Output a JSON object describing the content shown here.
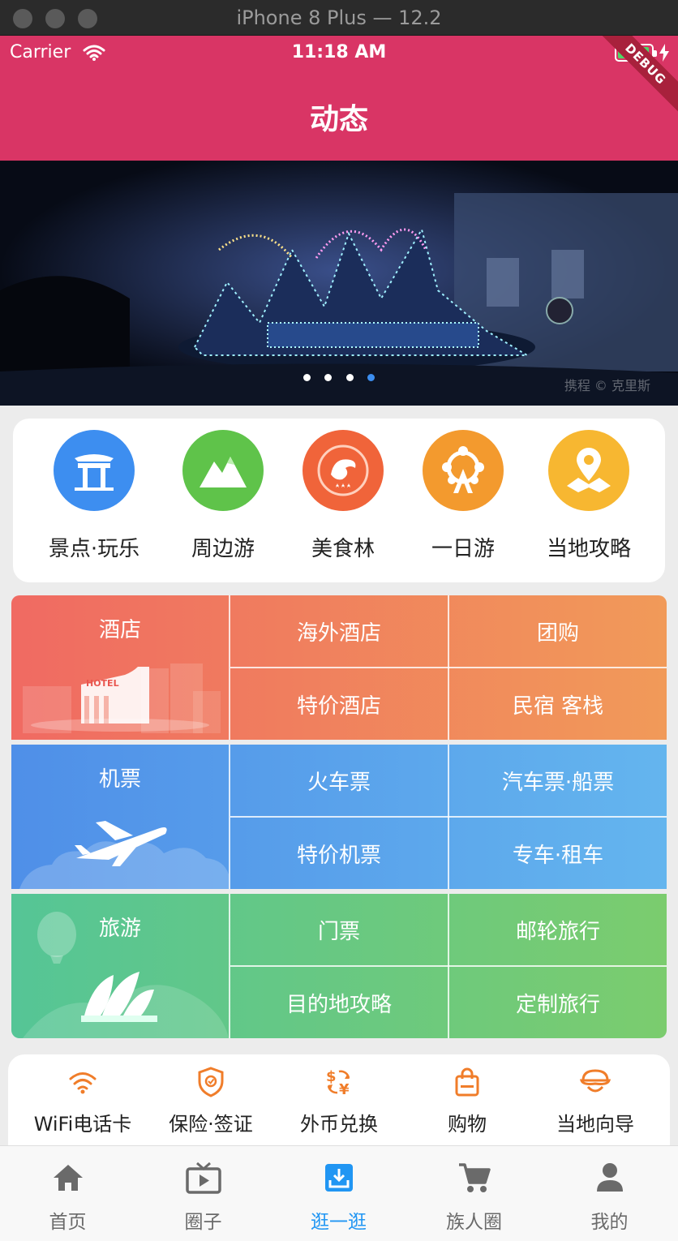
{
  "window": {
    "title": "iPhone 8 Plus — 12.2"
  },
  "status_bar": {
    "carrier": "Carrier",
    "time": "11:18 AM"
  },
  "debug_ribbon": "DEBUG",
  "header": {
    "title": "动态"
  },
  "banner": {
    "watermark": "携程 © 克里斯",
    "page_count": 4,
    "active_page": 4
  },
  "quick_nav": [
    {
      "label": "景点·玩乐",
      "icon": "pavilion-icon",
      "color": "#3d8ef0"
    },
    {
      "label": "周边游",
      "icon": "mountain-icon",
      "color": "#5fc34a"
    },
    {
      "label": "美食林",
      "icon": "dolphin-badge-icon",
      "color": "#f0643a"
    },
    {
      "label": "一日游",
      "icon": "ferris-wheel-icon",
      "color": "#f39a2e"
    },
    {
      "label": "当地攻略",
      "icon": "map-pin-icon",
      "color": "#f7b731"
    }
  ],
  "grid_nav": {
    "hotel": {
      "main": "酒店",
      "items": [
        "海外酒店",
        "团购",
        "特价酒店",
        "民宿 客栈"
      ],
      "sign": "HOTEL"
    },
    "flight": {
      "main": "机票",
      "items": [
        "火车票",
        "汽车票·船票",
        "特价机票",
        "专车·租车"
      ]
    },
    "travel": {
      "main": "旅游",
      "items": [
        "门票",
        "邮轮旅行",
        "目的地攻略",
        "定制旅行"
      ]
    }
  },
  "services": [
    {
      "label": "WiFi电话卡",
      "icon": "wifi-icon"
    },
    {
      "label": "保险·签证",
      "icon": "shield-check-icon"
    },
    {
      "label": "外币兑换",
      "icon": "currency-exchange-icon"
    },
    {
      "label": "购物",
      "icon": "shopping-bag-icon"
    },
    {
      "label": "当地向导",
      "icon": "guide-hat-icon"
    }
  ],
  "colors": {
    "header": "#d93565",
    "accent": "#2196f3",
    "service_icon": "#f07d2a"
  },
  "tabs": [
    {
      "label": "首页",
      "icon": "home-icon",
      "active": false
    },
    {
      "label": "圈子",
      "icon": "tv-play-icon",
      "active": false
    },
    {
      "label": "逛一逛",
      "icon": "download-box-icon",
      "active": true
    },
    {
      "label": "族人圈",
      "icon": "cart-icon",
      "active": false
    },
    {
      "label": "我的",
      "icon": "person-icon",
      "active": false
    }
  ]
}
